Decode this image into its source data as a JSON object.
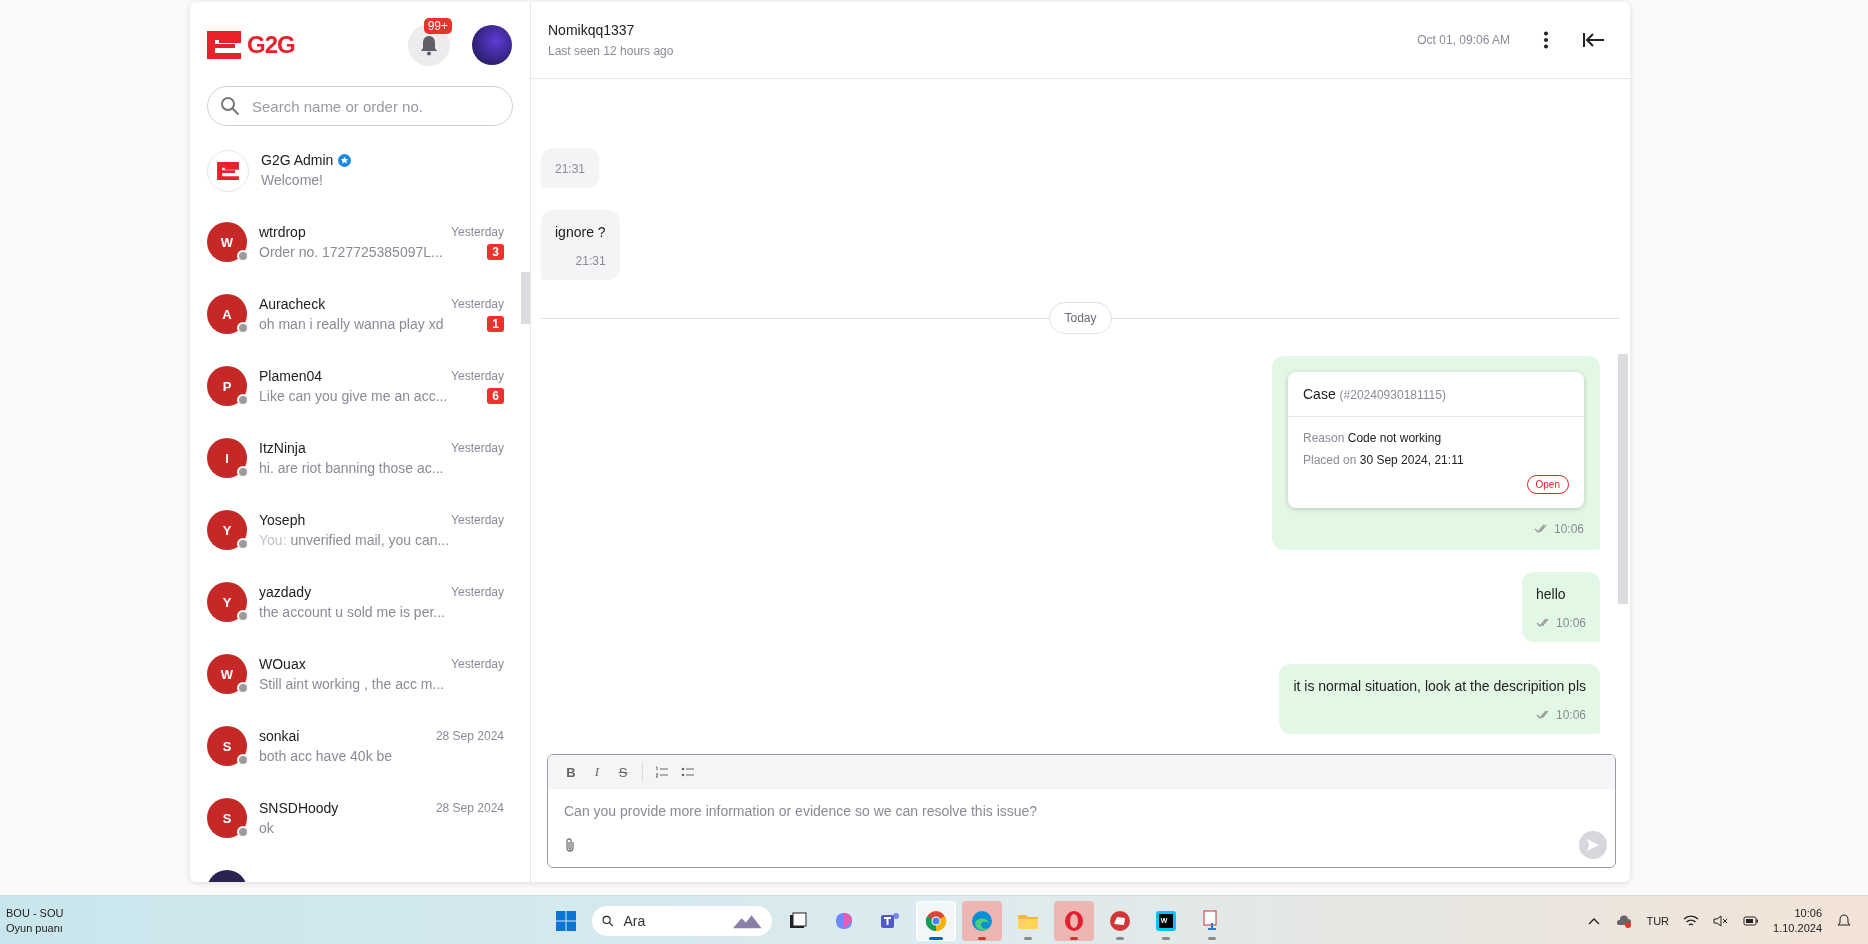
{
  "sidebar": {
    "logo": "G2G",
    "notifications": "99+",
    "search": {
      "placeholder": "Search name or order no."
    },
    "conversations": [
      {
        "kind": "admin",
        "name": "G2G Admin",
        "verified": true,
        "preview": "Welcome!"
      },
      {
        "kind": "user",
        "avatar": "W",
        "name": "wtrdrop",
        "time": "Yesterday",
        "preview": "Order no. 1727725385097L...",
        "unread": "3",
        "online": false
      },
      {
        "kind": "user",
        "avatar": "A",
        "name": "Auracheck",
        "time": "Yesterday",
        "preview": "oh man i really wanna play xd",
        "unread": "1",
        "online": false
      },
      {
        "kind": "user",
        "avatar": "P",
        "name": "Plamen04",
        "time": "Yesterday",
        "preview": "Like can you give me an acc...",
        "unread": "6",
        "online": false
      },
      {
        "kind": "user",
        "avatar": "I",
        "name": "ItzNinja",
        "time": "Yesterday",
        "preview": "hi. are riot banning those ac...",
        "online": false
      },
      {
        "kind": "user",
        "avatar": "Y",
        "name": "Yoseph",
        "time": "Yesterday",
        "prefix": "You:",
        "preview": "unverified mail, you can...",
        "online": false
      },
      {
        "kind": "user",
        "avatar": "Y",
        "name": "yazdady",
        "time": "Yesterday",
        "preview": "the account u sold me is per...",
        "online": false
      },
      {
        "kind": "user",
        "avatar": "W",
        "name": "WOuax",
        "time": "Yesterday",
        "preview": "Still aint working , the acc m...",
        "online": false
      },
      {
        "kind": "user",
        "avatar": "S",
        "name": "sonkai",
        "time": "28 Sep 2024",
        "preview": "both acc have 40k be",
        "online": false
      },
      {
        "kind": "user",
        "avatar": "S",
        "name": "SNSDHoody",
        "time": "28 Sep 2024",
        "preview": "ok",
        "online": false
      },
      {
        "kind": "photo"
      }
    ]
  },
  "chat": {
    "name": "Nomikqq1337",
    "status": "Last seen 12 hours ago",
    "date": "Oct 01, 09:06 AM",
    "messages": [
      {
        "kind": "incoming",
        "time": "21:31"
      },
      {
        "kind": "incoming",
        "text": "ignore ?",
        "time": "21:31"
      },
      {
        "kind": "divider",
        "text": "Today"
      },
      {
        "kind": "case",
        "title": "Case",
        "case_id": "(#20240930181115)",
        "fields": [
          {
            "label": "Reason",
            "value": "Code not working"
          },
          {
            "label": "Placed on",
            "value": "30 Sep 2024, 21:11"
          }
        ],
        "status": "Open",
        "time": "10:06"
      },
      {
        "kind": "outgoing",
        "text": "hello",
        "time": "10:06"
      },
      {
        "kind": "outgoing",
        "text": "it is normal situation, look at the descripition pls",
        "time": "10:06"
      }
    ],
    "composer": {
      "toolbar": [
        {
          "kind": "bold",
          "label": "B"
        },
        {
          "kind": "italic",
          "label": "I"
        },
        {
          "kind": "strike",
          "label": "S"
        },
        {
          "kind": "ordered-list"
        },
        {
          "kind": "bullet-list"
        }
      ],
      "placeholder": "Can you provide more information or evidence so we can resolve this issue?"
    }
  },
  "taskbar": {
    "widget": {
      "title": "BOU - SOU",
      "subtitle": "Oyun puanı"
    },
    "search": {
      "placeholder": "Ara"
    },
    "apps": [
      {
        "kind": "start",
        "selected": false,
        "attention": false,
        "running": false
      },
      {
        "kind": "search"
      },
      {
        "kind": "taskview",
        "selected": false,
        "attention": false,
        "running": false
      },
      {
        "kind": "copilot",
        "selected": false,
        "attention": false,
        "running": false
      },
      {
        "kind": "teams",
        "selected": false,
        "attention": false,
        "running": false
      },
      {
        "kind": "chrome",
        "selected": true,
        "attention": false,
        "running": true
      },
      {
        "kind": "edge",
        "selected": false,
        "attention": true,
        "running": true
      },
      {
        "kind": "explorer",
        "selected": false,
        "attention": false,
        "running": true
      },
      {
        "kind": "opera",
        "selected": false,
        "attention": true,
        "running": true
      },
      {
        "kind": "riot",
        "selected": false,
        "attention": false,
        "running": true
      },
      {
        "kind": "webstorm",
        "selected": false,
        "attention": false,
        "running": true
      },
      {
        "kind": "network-tool",
        "selected": false,
        "attention": false,
        "running": true
      }
    ],
    "language": "TUR",
    "time": "10:06",
    "date": "1.10.2024"
  }
}
